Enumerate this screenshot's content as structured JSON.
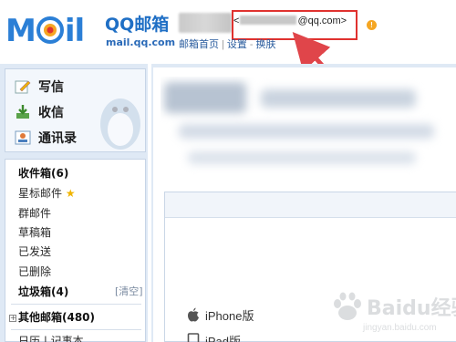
{
  "header": {
    "logo_text_m": "M",
    "logo_text_il": "il",
    "logo_product": "QQ邮箱",
    "logo_domain": "mail.qq.com",
    "email_prefix": "<",
    "email_suffix": "@qq.com>",
    "alert_badge": "!",
    "nav": {
      "home": "邮箱首页",
      "settings": "设置",
      "skin": "换肤"
    }
  },
  "sidebar": {
    "quick": [
      {
        "label": "写信",
        "icon": "pencil-note-icon"
      },
      {
        "label": "收信",
        "icon": "inbox-download-icon"
      },
      {
        "label": "通讯录",
        "icon": "contacts-card-icon"
      }
    ],
    "folders": {
      "inbox": "收件箱(6)",
      "starred": "星标邮件",
      "group": "群邮件",
      "drafts": "草稿箱",
      "sent": "已发送",
      "deleted": "已删除",
      "trash": "垃圾箱(4)",
      "trash_clear": "[清空]",
      "other": "其他邮箱(480)",
      "calendar": "日历 | 记事本"
    }
  },
  "main": {
    "apps": [
      {
        "label": "iPhone版",
        "icon": "apple-icon"
      },
      {
        "label": "iPad版",
        "icon": "tablet-icon"
      }
    ]
  },
  "watermark": {
    "text": "Baidu经验",
    "sub": "jingyan.baidu.com"
  },
  "colors": {
    "brand_blue": "#2b7fd6",
    "sidebar_bg": "#dfe9f5",
    "highlight_red": "#e0322f",
    "alert_orange": "#f5a623"
  }
}
